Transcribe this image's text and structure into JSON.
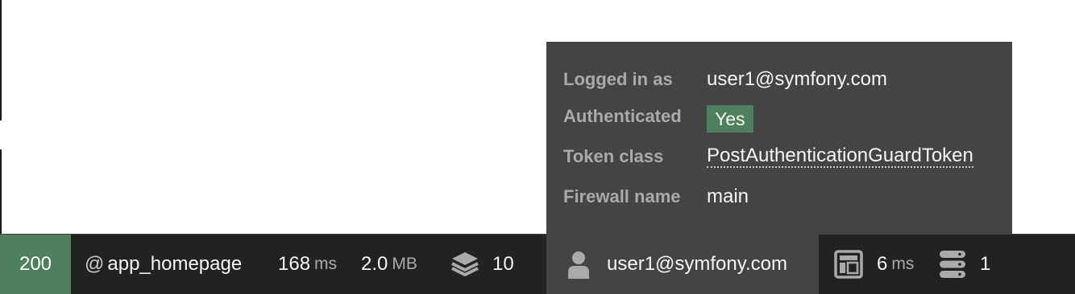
{
  "toolbar": {
    "status_code": "200",
    "route_prefix": "@",
    "route_name": "app_homepage",
    "time_value": "168",
    "time_unit": "ms",
    "memory_value": "2.0",
    "memory_unit": "MB",
    "events_count": "10",
    "user_name": "user1@symfony.com",
    "twig_value": "6",
    "twig_unit": "ms",
    "db_count": "1"
  },
  "security_popup": {
    "rows": [
      {
        "label": "Logged in as",
        "value": "user1@symfony.com"
      },
      {
        "label": "Authenticated",
        "value": "Yes"
      },
      {
        "label": "Token class",
        "value": "PostAuthenticationGuardToken"
      },
      {
        "label": "Firewall name",
        "value": "main"
      }
    ]
  },
  "colors": {
    "toolbar_bg": "#222222",
    "panel_bg": "#444444",
    "status_green": "#4f805d",
    "label_gray": "#aaaaaa"
  },
  "icons": [
    "layers-icon",
    "user-icon",
    "template-icon",
    "database-icon"
  ]
}
